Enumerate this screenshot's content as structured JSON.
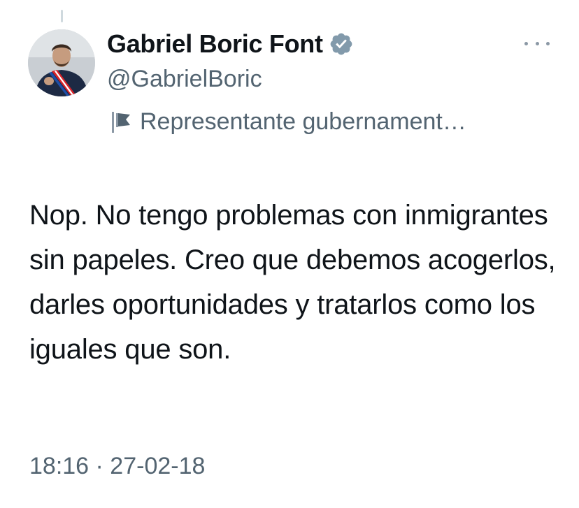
{
  "author": {
    "display_name": "Gabriel Boric Font",
    "handle": "@GabrielBoric",
    "verified_badge_color": "#829aab",
    "affiliation_label": "Representante gubernament…",
    "avatar_icon": "profile-photo"
  },
  "tweet": {
    "text": "Nop. No tengo problemas con inmigrantes sin papeles. Creo que debemos acogerlos, darles oportunidades y tratarlos como los iguales que son.",
    "timestamp": "18:16 · 27-02-18"
  },
  "colors": {
    "text_primary": "#0f1419",
    "text_secondary": "#536471",
    "background": "#ffffff"
  }
}
